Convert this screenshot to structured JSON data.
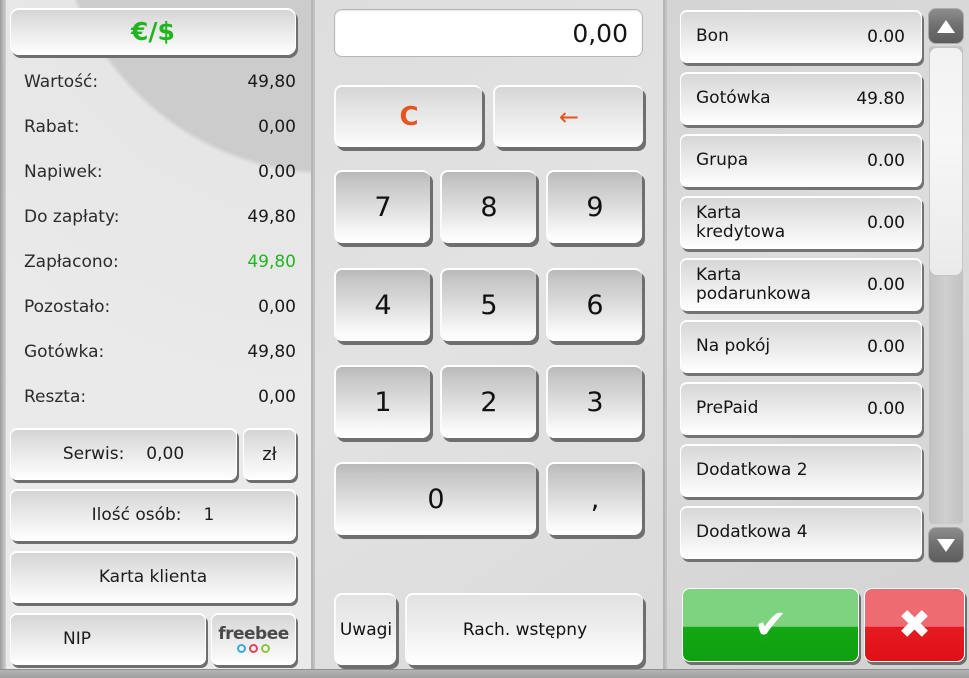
{
  "left": {
    "currency_button": "€/$",
    "summary": [
      {
        "label": "Wartość:",
        "value": "49,80",
        "highlight": false
      },
      {
        "label": "Rabat:",
        "value": "0,00",
        "highlight": false
      },
      {
        "label": "Napiwek:",
        "value": "0,00",
        "highlight": false
      },
      {
        "label": "Do zapłaty:",
        "value": "49,80",
        "highlight": false
      },
      {
        "label": "Zapłacono:",
        "value": "49,80",
        "highlight": true
      },
      {
        "label": "Pozostało:",
        "value": "0,00",
        "highlight": false
      },
      {
        "label": "Gotówka:",
        "value": "49,80",
        "highlight": false
      },
      {
        "label": "Reszta:",
        "value": "0,00",
        "highlight": false
      }
    ],
    "serwis_label": "Serwis:",
    "serwis_value": "0,00",
    "currency_unit": "zł",
    "osob_label": "Ilość osób:",
    "osob_value": "1",
    "karta_klienta": "Karta klienta",
    "nip": "NIP",
    "freebee_word": "freebee"
  },
  "keypad": {
    "display_value": "0,00",
    "clear_label": "C",
    "backspace_label": "←",
    "keys": [
      "7",
      "8",
      "9",
      "4",
      "5",
      "6",
      "1",
      "2",
      "3"
    ],
    "zero_label": "0",
    "comma_label": ",",
    "uwagi_label": "Uwagi",
    "rach_label": "Rach. wstępny"
  },
  "payments": {
    "items": [
      {
        "name": "Bon",
        "amount": "0.00"
      },
      {
        "name": "Gotówka",
        "amount": "49.80"
      },
      {
        "name": "Grupa",
        "amount": "0.00"
      },
      {
        "name": "Karta\nkredytowa",
        "amount": "0.00"
      },
      {
        "name": "Karta\npodarunkowa",
        "amount": "0.00"
      },
      {
        "name": "Na pokój",
        "amount": "0.00"
      },
      {
        "name": "PrePaid",
        "amount": "0.00"
      },
      {
        "name": "Dodatkowa 2",
        "amount": ""
      },
      {
        "name": "Dodatkowa 4",
        "amount": ""
      }
    ],
    "confirm_glyph": "✔",
    "cancel_glyph": "✖"
  },
  "colors": {
    "accent_green": "#20b520",
    "confirm_green": "#0fa00f",
    "cancel_red": "#e00f17",
    "clear_orange": "#e8551c"
  }
}
